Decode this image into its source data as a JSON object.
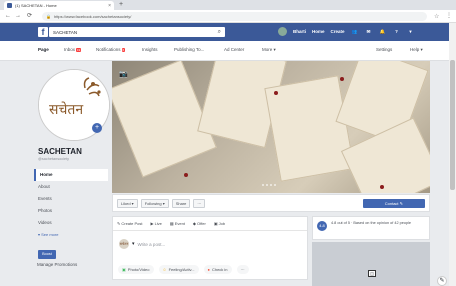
{
  "browser": {
    "tab_title": "(1) SACHETAN - Home",
    "tab_close": "×",
    "new_tab": "+",
    "url": "https://www.facebook.com/sachetansociety/",
    "back_icon": "back-arrow-icon",
    "forward_icon": "forward-arrow-icon",
    "reload_icon": "reload-icon"
  },
  "fb_header": {
    "logo": "f",
    "search_value": "SACHETAN",
    "user_name": "Bharti",
    "home": "Home",
    "create": "Create"
  },
  "page_nav": {
    "items": [
      {
        "label": "Page",
        "badge": ""
      },
      {
        "label": "Inbox",
        "badge": "19"
      },
      {
        "label": "Notifications",
        "badge": "6"
      },
      {
        "label": "Insights",
        "badge": ""
      },
      {
        "label": "Publishing To...",
        "badge": ""
      },
      {
        "label": "Ad Center",
        "badge": ""
      },
      {
        "label": "More ▾",
        "badge": ""
      }
    ],
    "settings": "Settings",
    "help": "Help ▾"
  },
  "page": {
    "name": "SACHETAN",
    "handle": "@sachetansociety",
    "logo_text": "सचेतन"
  },
  "left_menu": {
    "items": [
      "Home",
      "About",
      "Events",
      "Photos",
      "Videos"
    ],
    "see_more": "▾ See more",
    "promote": "Boost",
    "manage_promotions": "Manage Promotions"
  },
  "actions": {
    "liked": "Liked ▾",
    "following": "Following ▾",
    "share": "Share",
    "more": "···",
    "contact": "Contact ✎"
  },
  "composer": {
    "tabs": [
      "Create Post",
      "Live",
      "Event",
      "Offer",
      "Job"
    ],
    "placeholder": "Write a post...",
    "buttons": [
      "Photo/Video",
      "Feeling/Activ...",
      "Check in",
      "···"
    ]
  },
  "rating": {
    "score": "4.8",
    "text": "4.8 out of 5 · Based on the opinion of 42 people"
  },
  "colors": {
    "fb_blue": "#3b5998",
    "accent": "#4267b2",
    "badge_red": "#fa3e3e"
  }
}
